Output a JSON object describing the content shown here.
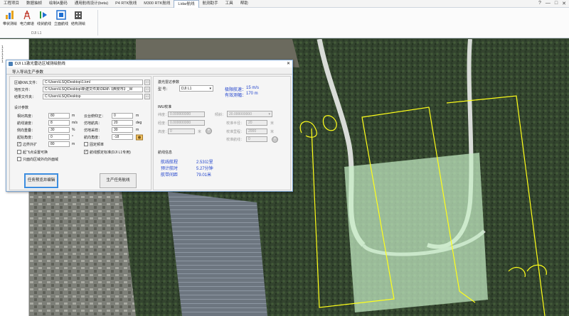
{
  "tabs": [
    "工程项目",
    "数据抽帧",
    "绘制A量码",
    "通用航线设计(beta)",
    "P4 RTK航线",
    "M300 RTK航线",
    "Lidar航线",
    "航测助手",
    "工具",
    "帮助"
  ],
  "active_tab_index": 6,
  "window_controls": [
    "?",
    "—",
    "□",
    "✕"
  ],
  "ribbon": {
    "buttons": [
      {
        "label": "带状测绘",
        "icon": "bar-chart-icon"
      },
      {
        "label": "电力廊道",
        "icon": "power-line-icon"
      },
      {
        "label": "线状航线",
        "icon": "line-route-icon"
      },
      {
        "label": "立面航线",
        "icon": "facade-route-icon"
      },
      {
        "label": "结构测绘",
        "icon": "building-icon"
      }
    ],
    "group_label": "DJI L1"
  },
  "left_panel": {
    "items": [
      "1",
      "1",
      "1",
      "1",
      "1"
    ]
  },
  "dialog": {
    "title": "DJI L1激光雷达区域测绘航线",
    "close": "✕",
    "section_header": "导入导出生产参数",
    "files": {
      "kml_label": "区域KML文件：",
      "kml_value": "C:\\Users\\LSQ\\Desktop\\1.kml",
      "dem_label": "地形文件：",
      "dem_value": "C:\\Users\\LSQ\\Desktop\\新建文件夹\\DEM\\【西安市】_W",
      "out_label": "结果文件夹：",
      "out_value": "C:\\Users\\LSQ\\Desktop",
      "browse": "..."
    },
    "design": {
      "header": "设计参数",
      "rel_height_label": "相对高度：",
      "rel_height": "80",
      "rel_height_unit": "m",
      "speed_label": "航线速度：",
      "speed": "8",
      "speed_unit": "m/s",
      "side_overlap_label": "侧向重叠：",
      "side_overlap": "30",
      "side_overlap_unit": "%",
      "heading_label": "起始角度：",
      "heading": "0",
      "heading_unit": "°",
      "boundary_label": "边界外扩",
      "boundary": "80",
      "boundary_unit": "m",
      "start_at_boundary_label": "起飞点设置可换",
      "use_kml_label": "只面向区域外向外面域",
      "pitch_label": "云台俯仰正：",
      "pitch": "0",
      "pitch_unit": "m",
      "yaw_label": "仿地航高：",
      "yaw": "20",
      "yaw_unit": "deg",
      "terrain_follow_label": "仿地采样：",
      "terrain_follow": "30",
      "terrain_follow_unit": "m",
      "azimuth_label": "航向角度：",
      "azimuth": "-18",
      "azimuth_unit": "°",
      "fixed_label": "固定频率",
      "l1_label": "航线额定标准(DJI L1专用)"
    },
    "lidar": {
      "header": "激光雷达参数",
      "model_label": "型 号：",
      "model_value": "DJI L1",
      "limit_speed_label": "极限航速：",
      "limit_speed": "15 m/s",
      "eff_width_label": "有效测幅：",
      "eff_width": "170 m"
    },
    "imu": {
      "header": "IMU校准",
      "lat_label": "纬度：",
      "lat": "0.000000000",
      "lon_label": "经度：",
      "lon": "0.000000000",
      "alt_label": "高度：",
      "alt": "0",
      "alt_unit": "米",
      "tilt_label": "倾斜：",
      "tilt": "20.000000000",
      "radius_label": "校准半径：",
      "radius": "20",
      "radius_unit": "米",
      "count_label": "校准里程：",
      "count": "2000",
      "count_unit": "米",
      "num_label": "校准航线：",
      "num": "0"
    },
    "info": {
      "header": "航线信息",
      "length_label": "航线航程",
      "length": "2.53公里",
      "time_label": "预计航时",
      "time": "5.27分钟",
      "spacing_label": "航带间距",
      "spacing": "79.01米"
    },
    "btn_preview": "任务预览并编辑",
    "btn_generate": "生产任务航线"
  },
  "colors": {
    "route": "#ffff1a",
    "area_fill": "#c8f0c8",
    "accent": "#2244cc"
  }
}
